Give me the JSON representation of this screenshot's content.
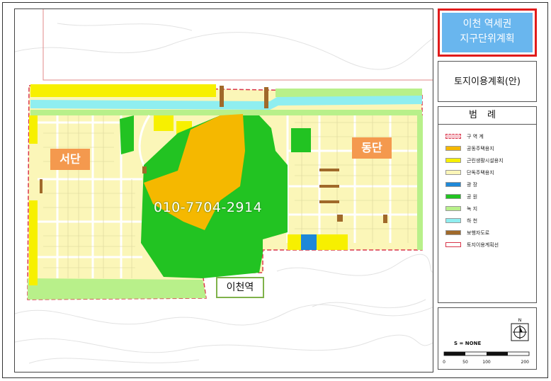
{
  "title": {
    "line1": "이천 역세권",
    "line2": "지구단위계획"
  },
  "subtitle": "토지이용계획(안)",
  "legend": {
    "heading": "범례",
    "items": [
      {
        "label": "구 역 계",
        "color": "#d9354a",
        "style": "dash"
      },
      {
        "label": "공동주택용지",
        "color": "#f5b800",
        "style": "fill"
      },
      {
        "label": "근린생활시설용지",
        "color": "#f7f000",
        "style": "fill"
      },
      {
        "label": "단독주택용지",
        "color": "#fbf6b8",
        "style": "fill"
      },
      {
        "label": "광 장",
        "color": "#1e88d8",
        "style": "fill"
      },
      {
        "label": "공 원",
        "color": "#22c322",
        "style": "fill"
      },
      {
        "label": "녹 지",
        "color": "#b8f08a",
        "style": "fill"
      },
      {
        "label": "하 천",
        "color": "#8feef0",
        "style": "fill"
      },
      {
        "label": "보행자도로",
        "color": "#a0692a",
        "style": "fill"
      },
      {
        "label": "토지이용계획선",
        "color": "#d9354a",
        "style": "outline"
      }
    ]
  },
  "scale": {
    "label": "S = NONE",
    "ticks": [
      "0",
      "50",
      "100",
      "200"
    ],
    "north": "N"
  },
  "map_labels": {
    "west": "서단",
    "east": "동단",
    "station": "이천역",
    "phone": "010-7704-2914"
  },
  "colors": {
    "park": "#22c322",
    "apartment": "#f5b800",
    "detached": "#fbf6b8",
    "commercial": "#f7f000",
    "green": "#b8f08a",
    "river": "#8feef0"
  }
}
